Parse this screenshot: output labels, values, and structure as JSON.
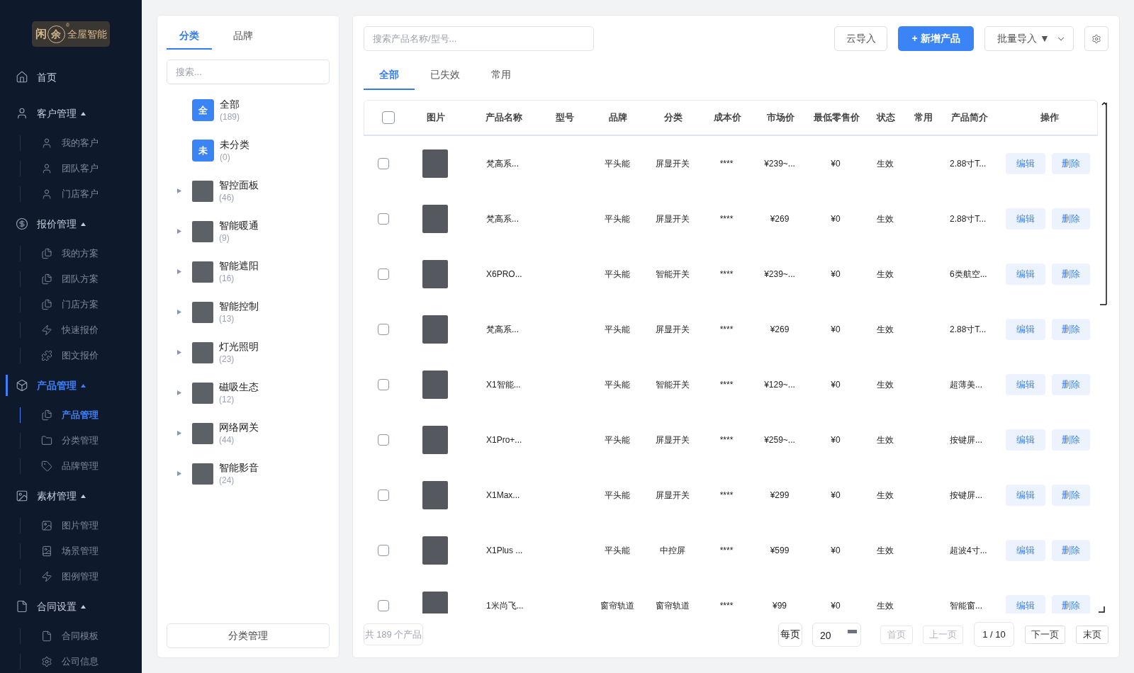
{
  "sidebar": {
    "logo": {
      "left_char": "闲",
      "circled_char": "余",
      "registered_mark": "®",
      "text": "全屋智能"
    },
    "nav": [
      {
        "label": "首页",
        "selected": false
      },
      {
        "label": "客户管理",
        "selected": false,
        "expanded": true,
        "children": [
          {
            "label": "我的客户",
            "selected": false
          },
          {
            "label": "团队客户",
            "selected": false
          },
          {
            "label": "门店客户",
            "selected": false
          }
        ]
      },
      {
        "label": "报价管理",
        "selected": false,
        "expanded": true,
        "children": [
          {
            "label": "我的方案",
            "selected": false
          },
          {
            "label": "团队方案",
            "selected": false
          },
          {
            "label": "门店方案",
            "selected": false
          },
          {
            "label": "快速报价",
            "selected": false
          },
          {
            "label": "图文报价",
            "selected": false
          }
        ]
      },
      {
        "label": "产品管理",
        "selected": true,
        "expanded": true,
        "children": [
          {
            "label": "产品管理",
            "selected": true
          },
          {
            "label": "分类管理",
            "selected": false
          },
          {
            "label": "品牌管理",
            "selected": false
          }
        ]
      },
      {
        "label": "素材管理",
        "selected": false,
        "expanded": true,
        "children": [
          {
            "label": "图片管理",
            "selected": false
          },
          {
            "label": "场景管理",
            "selected": false
          },
          {
            "label": "图例管理",
            "selected": false
          }
        ]
      },
      {
        "label": "合同设置",
        "selected": false,
        "expanded": true,
        "children": [
          {
            "label": "合同模板",
            "selected": false
          },
          {
            "label": "公司信息",
            "selected": false
          }
        ]
      }
    ]
  },
  "category_panel": {
    "tabs": [
      {
        "label": "分类",
        "selected": true
      },
      {
        "label": "品牌",
        "selected": false
      }
    ],
    "search": {
      "placeholder": "搜索..."
    },
    "items": [
      {
        "kind": "letter",
        "badge": "全",
        "name": "全部",
        "count": "(189)"
      },
      {
        "kind": "letter",
        "badge": "未",
        "name": "未分类",
        "count": "(0)"
      },
      {
        "kind": "photo",
        "name": "智控面板",
        "count": "(46)",
        "expanded": false
      },
      {
        "kind": "photo",
        "name": "智能暖通",
        "count": "(9)",
        "expanded": false
      },
      {
        "kind": "photo",
        "name": "智能遮阳",
        "count": "(16)",
        "expanded": false
      },
      {
        "kind": "photo",
        "name": "智能控制",
        "count": "(13)",
        "expanded": false
      },
      {
        "kind": "photo",
        "name": "灯光照明",
        "count": "(23)",
        "expanded": false
      },
      {
        "kind": "photo",
        "name": "磁吸生态",
        "count": "(12)",
        "expanded": false
      },
      {
        "kind": "photo",
        "name": "网络网关",
        "count": "(44)",
        "expanded": false
      },
      {
        "kind": "photo",
        "name": "智能影音",
        "count": "(24)",
        "expanded": false
      }
    ],
    "manage_button": "分类管理"
  },
  "products": {
    "search": {
      "placeholder": "搜索产品名称/型号..."
    },
    "toolbar": [
      {
        "kind": "outline",
        "label": "云导入"
      },
      {
        "kind": "primary",
        "label": "+ 新增产品"
      },
      {
        "kind": "dropdown",
        "label": "批量导入 ▼"
      },
      {
        "kind": "settings"
      }
    ],
    "tabs": [
      {
        "label": "全部",
        "selected": true
      },
      {
        "label": "已失效",
        "selected": false
      },
      {
        "label": "常用",
        "selected": false
      }
    ],
    "table": {
      "header_checkbox": {
        "checked": false
      },
      "columns": [
        "图片",
        "产品名称",
        "型号",
        "品牌",
        "分类",
        "成本价",
        "市场价",
        "最低零售价",
        "状态",
        "常用",
        "产品简介",
        "操作"
      ],
      "rows": [
        {
          "checked": false,
          "name": "梵高系...",
          "brand": "平头能",
          "category": "屏显开关",
          "cost": "****",
          "market_price": "¥239~...",
          "min_price": "¥0",
          "status": "生效",
          "intro": "2.88寸T...",
          "actions": [
            "编辑",
            "删除"
          ]
        },
        {
          "checked": false,
          "name": "梵高系...",
          "brand": "平头能",
          "category": "屏显开关",
          "cost": "****",
          "market_price": "¥269",
          "min_price": "¥0",
          "status": "生效",
          "intro": "2.88寸T...",
          "actions": [
            "编辑",
            "删除"
          ]
        },
        {
          "checked": false,
          "name": "X6PRO...",
          "brand": "平头能",
          "category": "智能开关",
          "cost": "****",
          "market_price": "¥239~...",
          "min_price": "¥0",
          "status": "生效",
          "intro": "6类航空...",
          "actions": [
            "编辑",
            "删除"
          ]
        },
        {
          "checked": false,
          "name": "梵高系...",
          "brand": "平头能",
          "category": "屏显开关",
          "cost": "****",
          "market_price": "¥269",
          "min_price": "¥0",
          "status": "生效",
          "intro": "2.88寸T...",
          "actions": [
            "编辑",
            "删除"
          ]
        },
        {
          "checked": false,
          "name": "X1智能...",
          "brand": "平头能",
          "category": "智能开关",
          "cost": "****",
          "market_price": "¥129~...",
          "min_price": "¥0",
          "status": "生效",
          "intro": "超薄美...",
          "actions": [
            "编辑",
            "删除"
          ]
        },
        {
          "checked": false,
          "name": "X1Pro+...",
          "brand": "平头能",
          "category": "屏显开关",
          "cost": "****",
          "market_price": "¥259~...",
          "min_price": "¥0",
          "status": "生效",
          "intro": "按键屏...",
          "actions": [
            "编辑",
            "删除"
          ]
        },
        {
          "checked": false,
          "name": "X1Max...",
          "brand": "平头能",
          "category": "屏显开关",
          "cost": "****",
          "market_price": "¥299",
          "min_price": "¥0",
          "status": "生效",
          "intro": "按键屏...",
          "actions": [
            "编辑",
            "删除"
          ]
        },
        {
          "checked": false,
          "name": "X1Plus ...",
          "brand": "平头能",
          "category": "中控屏",
          "cost": "****",
          "market_price": "¥599",
          "min_price": "¥0",
          "status": "生效",
          "intro": "超波4寸...",
          "actions": [
            "编辑",
            "删除"
          ]
        },
        {
          "checked": false,
          "name": "1米尚飞...",
          "brand": "窗帘轨道",
          "category": "窗帘轨道",
          "cost": "****",
          "market_price": "¥99",
          "min_price": "¥0",
          "status": "生效",
          "intro": "智能窗...",
          "actions": [
            "编辑",
            "删除"
          ]
        }
      ]
    },
    "footer": {
      "total": "共 189 个产品",
      "per_page_label": "每页",
      "page_size": "20",
      "pager": [
        {
          "kind": "button",
          "label": "首页",
          "disabled": true
        },
        {
          "kind": "button",
          "label": "上一页",
          "disabled": true
        },
        {
          "kind": "indicator",
          "label": "1 / 10",
          "disabled": false
        },
        {
          "kind": "button",
          "label": "下一页",
          "disabled": false
        },
        {
          "kind": "button",
          "label": "末页",
          "disabled": false
        }
      ]
    }
  }
}
